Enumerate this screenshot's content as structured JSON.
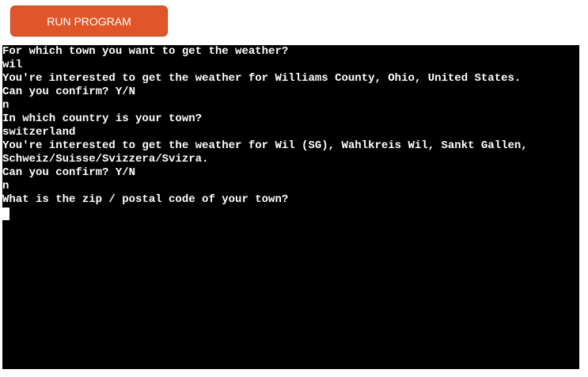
{
  "toolbar": {
    "run_label": "RUN PROGRAM"
  },
  "terminal": {
    "lines": [
      "For which town you want to get the weather?",
      "wil",
      "You're interested to get the weather for Williams County, Ohio, United States.",
      "Can you confirm? Y/N",
      "n",
      "In which country is your town?",
      "switzerland",
      "You're interested to get the weather for Wil (SG), Wahlkreis Wil, Sankt Gallen,",
      "Schweiz/Suisse/Svizzera/Svizra.",
      "Can you confirm? Y/N",
      "n",
      "What is the zip / postal code of your town?"
    ]
  },
  "colors": {
    "button_bg": "#e0562a",
    "terminal_bg": "#000000",
    "terminal_fg": "#ffffff"
  }
}
